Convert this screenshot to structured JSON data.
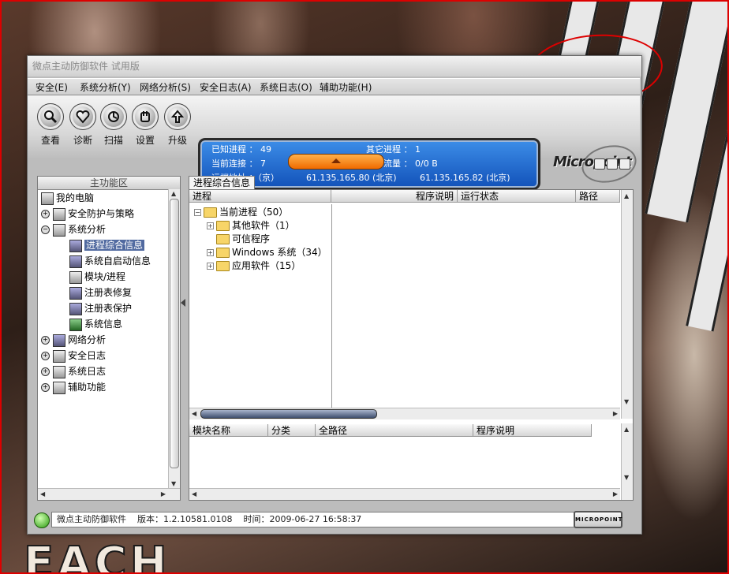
{
  "window": {
    "title": "微点主动防御软件  试用版"
  },
  "menu": [
    "安全(E)",
    "系统分析(Y)",
    "网络分析(S)",
    "安全日志(A)",
    "系统日志(O)",
    "辅助功能(H)"
  ],
  "toolbar": {
    "buttons": [
      {
        "label": "查看",
        "icon": "magnifier-icon"
      },
      {
        "label": "诊断",
        "icon": "heart-check-icon"
      },
      {
        "label": "扫描",
        "icon": "scan-icon"
      },
      {
        "label": "设置",
        "icon": "hand-settings-icon"
      },
      {
        "label": "升级",
        "icon": "upgrade-icon"
      }
    ]
  },
  "info_panel": {
    "known_process_label": "已知进程 ： 49",
    "other_process_label": "其它进程 ： 1",
    "connections_label": "当前连接 ： 7",
    "traffic_label": "当前流量 ： 0/0 B",
    "remote_label": "远端地址 ：（京）",
    "remote_ip1": "61.135.165.80 (北京)",
    "remote_ip2": "61.135.165.82 (北京)"
  },
  "logo": {
    "text": "Micropoint"
  },
  "left_panel": {
    "header": "主功能区",
    "items": [
      {
        "label": "我的电脑"
      },
      {
        "label": "安全防护与策略"
      },
      {
        "label": "系统分析"
      },
      {
        "label": "进程综合信息"
      },
      {
        "label": "系统自启动信息"
      },
      {
        "label": "模块/进程"
      },
      {
        "label": "注册表修复"
      },
      {
        "label": "注册表保护"
      },
      {
        "label": "系统信息"
      },
      {
        "label": "网络分析"
      },
      {
        "label": "安全日志"
      },
      {
        "label": "系统日志"
      },
      {
        "label": "辅助功能"
      }
    ]
  },
  "main": {
    "tab": "进程综合信息",
    "process_columns": [
      "进程",
      "程序说明",
      "运行状态",
      "路径"
    ],
    "process_tree": [
      {
        "label": "当前进程（50）"
      },
      {
        "label": "其他软件（1）"
      },
      {
        "label": "可信程序"
      },
      {
        "label": "Windows 系统（34）"
      },
      {
        "label": "应用软件（15）"
      }
    ],
    "module_columns": [
      "模块名称",
      "分类",
      "全路径",
      "程序说明"
    ]
  },
  "status": {
    "app": "微点主动防御软件",
    "version": "版本：1.2.10581.0108",
    "time": "时间：2009-06-27 16:58:37",
    "badge": "MICROPOINT"
  },
  "desktop": {
    "brand_text": "EACH"
  },
  "colors": {
    "info_bg": "#1e64cc",
    "selected": "#516aa0",
    "accent_orange": "#f07a00",
    "annotation_red": "#dd0000"
  }
}
